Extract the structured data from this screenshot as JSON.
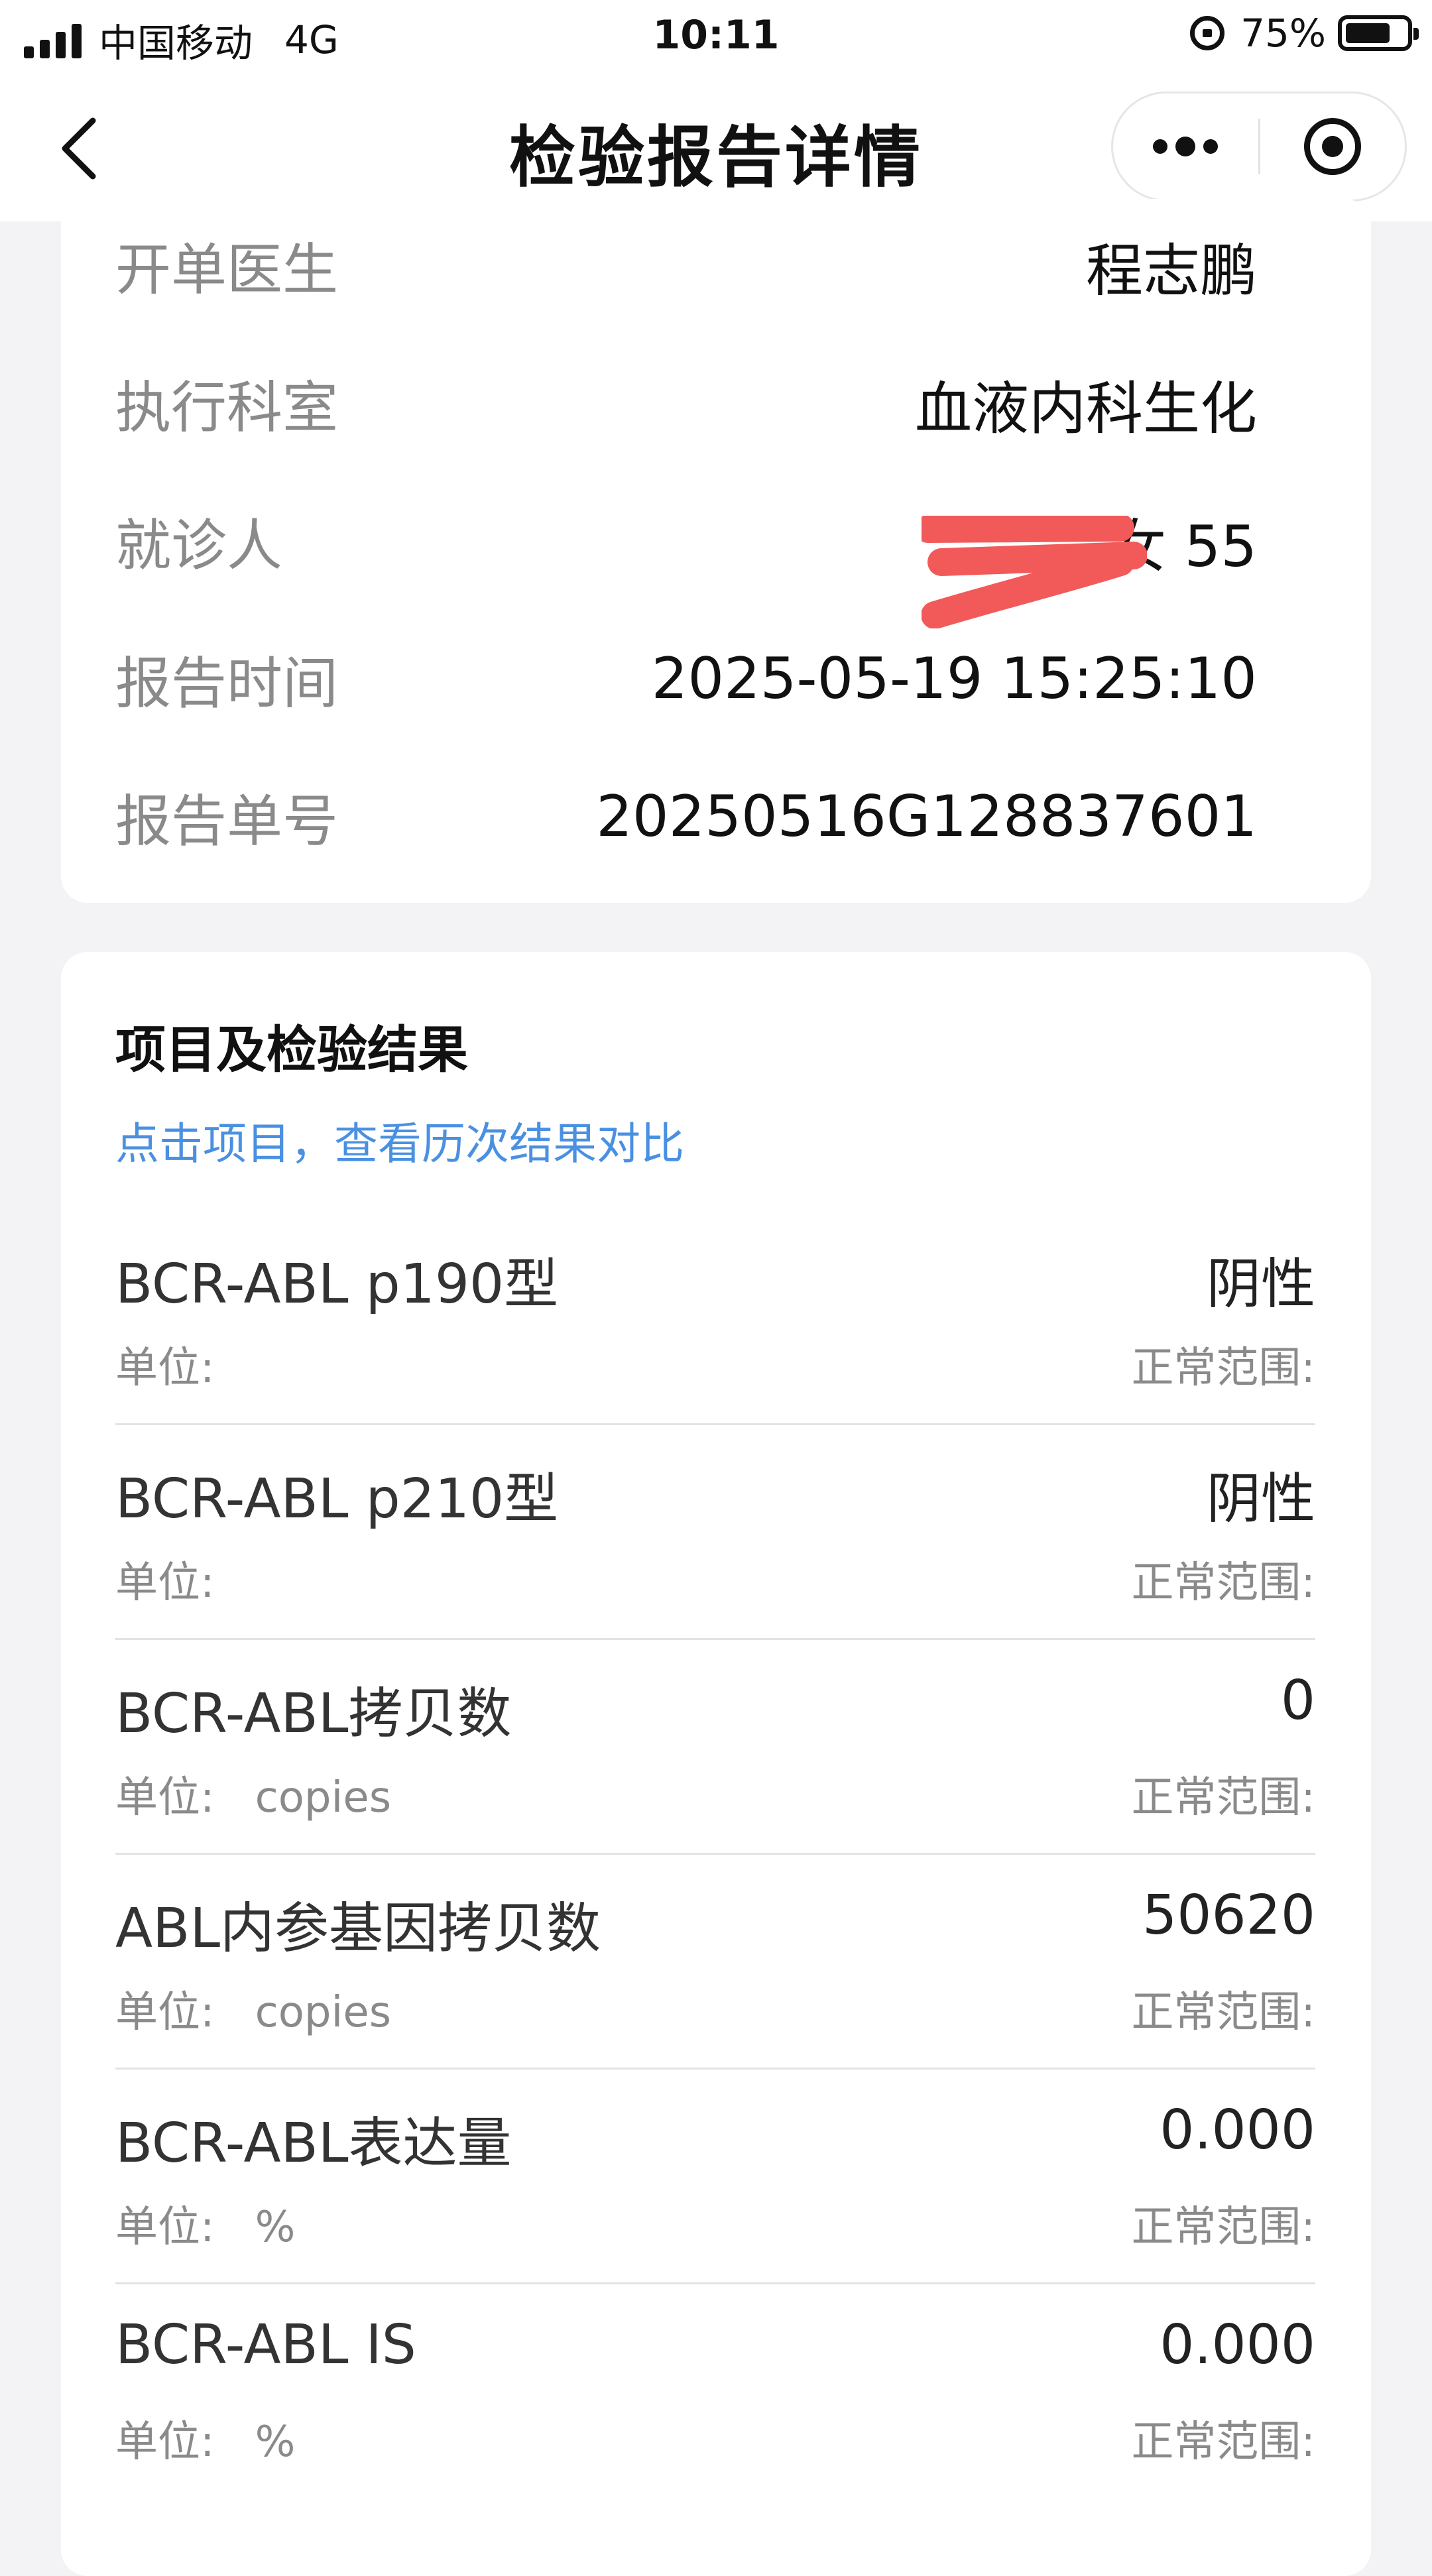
{
  "status_bar": {
    "carrier": "中国移动",
    "network": "4G",
    "time": "10:11",
    "battery": "75%",
    "battery_level": 0.75
  },
  "nav": {
    "title": "检验报告详情"
  },
  "report_info": {
    "rows": [
      {
        "label": "开单医生",
        "value": "程志鹏"
      },
      {
        "label": "执行科室",
        "value": "血液内科生化"
      },
      {
        "label": "就诊人",
        "value": "女 55"
      },
      {
        "label": "报告时间",
        "value": "2025-05-19 15:25:10"
      },
      {
        "label": "报告单号",
        "value": "20250516G128837601"
      }
    ]
  },
  "results": {
    "title": "项目及检验结果",
    "hint": "点击项目，查看历次结果对比",
    "items": [
      {
        "name": "BCR-ABL p190型",
        "value": "阴性",
        "unit": "单位:",
        "range": "正常范围:"
      },
      {
        "name": "BCR-ABL p210型",
        "value": "阴性",
        "unit": "单位:",
        "range": "正常范围:"
      },
      {
        "name": "BCR-ABL拷贝数",
        "value": "0",
        "unit": "单位:   copies",
        "range": "正常范围:"
      },
      {
        "name": "ABL内参基因拷贝数",
        "value": "50620",
        "unit": "单位:   copies",
        "range": "正常范围:"
      },
      {
        "name": "BCR-ABL表达量",
        "value": "0.000",
        "unit": "单位:   %",
        "range": "正常范围:"
      },
      {
        "name": "BCR-ABL IS",
        "value": "0.000",
        "unit": "单位:   %",
        "range": "正常范围:"
      }
    ]
  },
  "colors": {
    "accent": "#4a90e2",
    "redaction": "#f25a5a",
    "background": "#f3f3f5"
  }
}
